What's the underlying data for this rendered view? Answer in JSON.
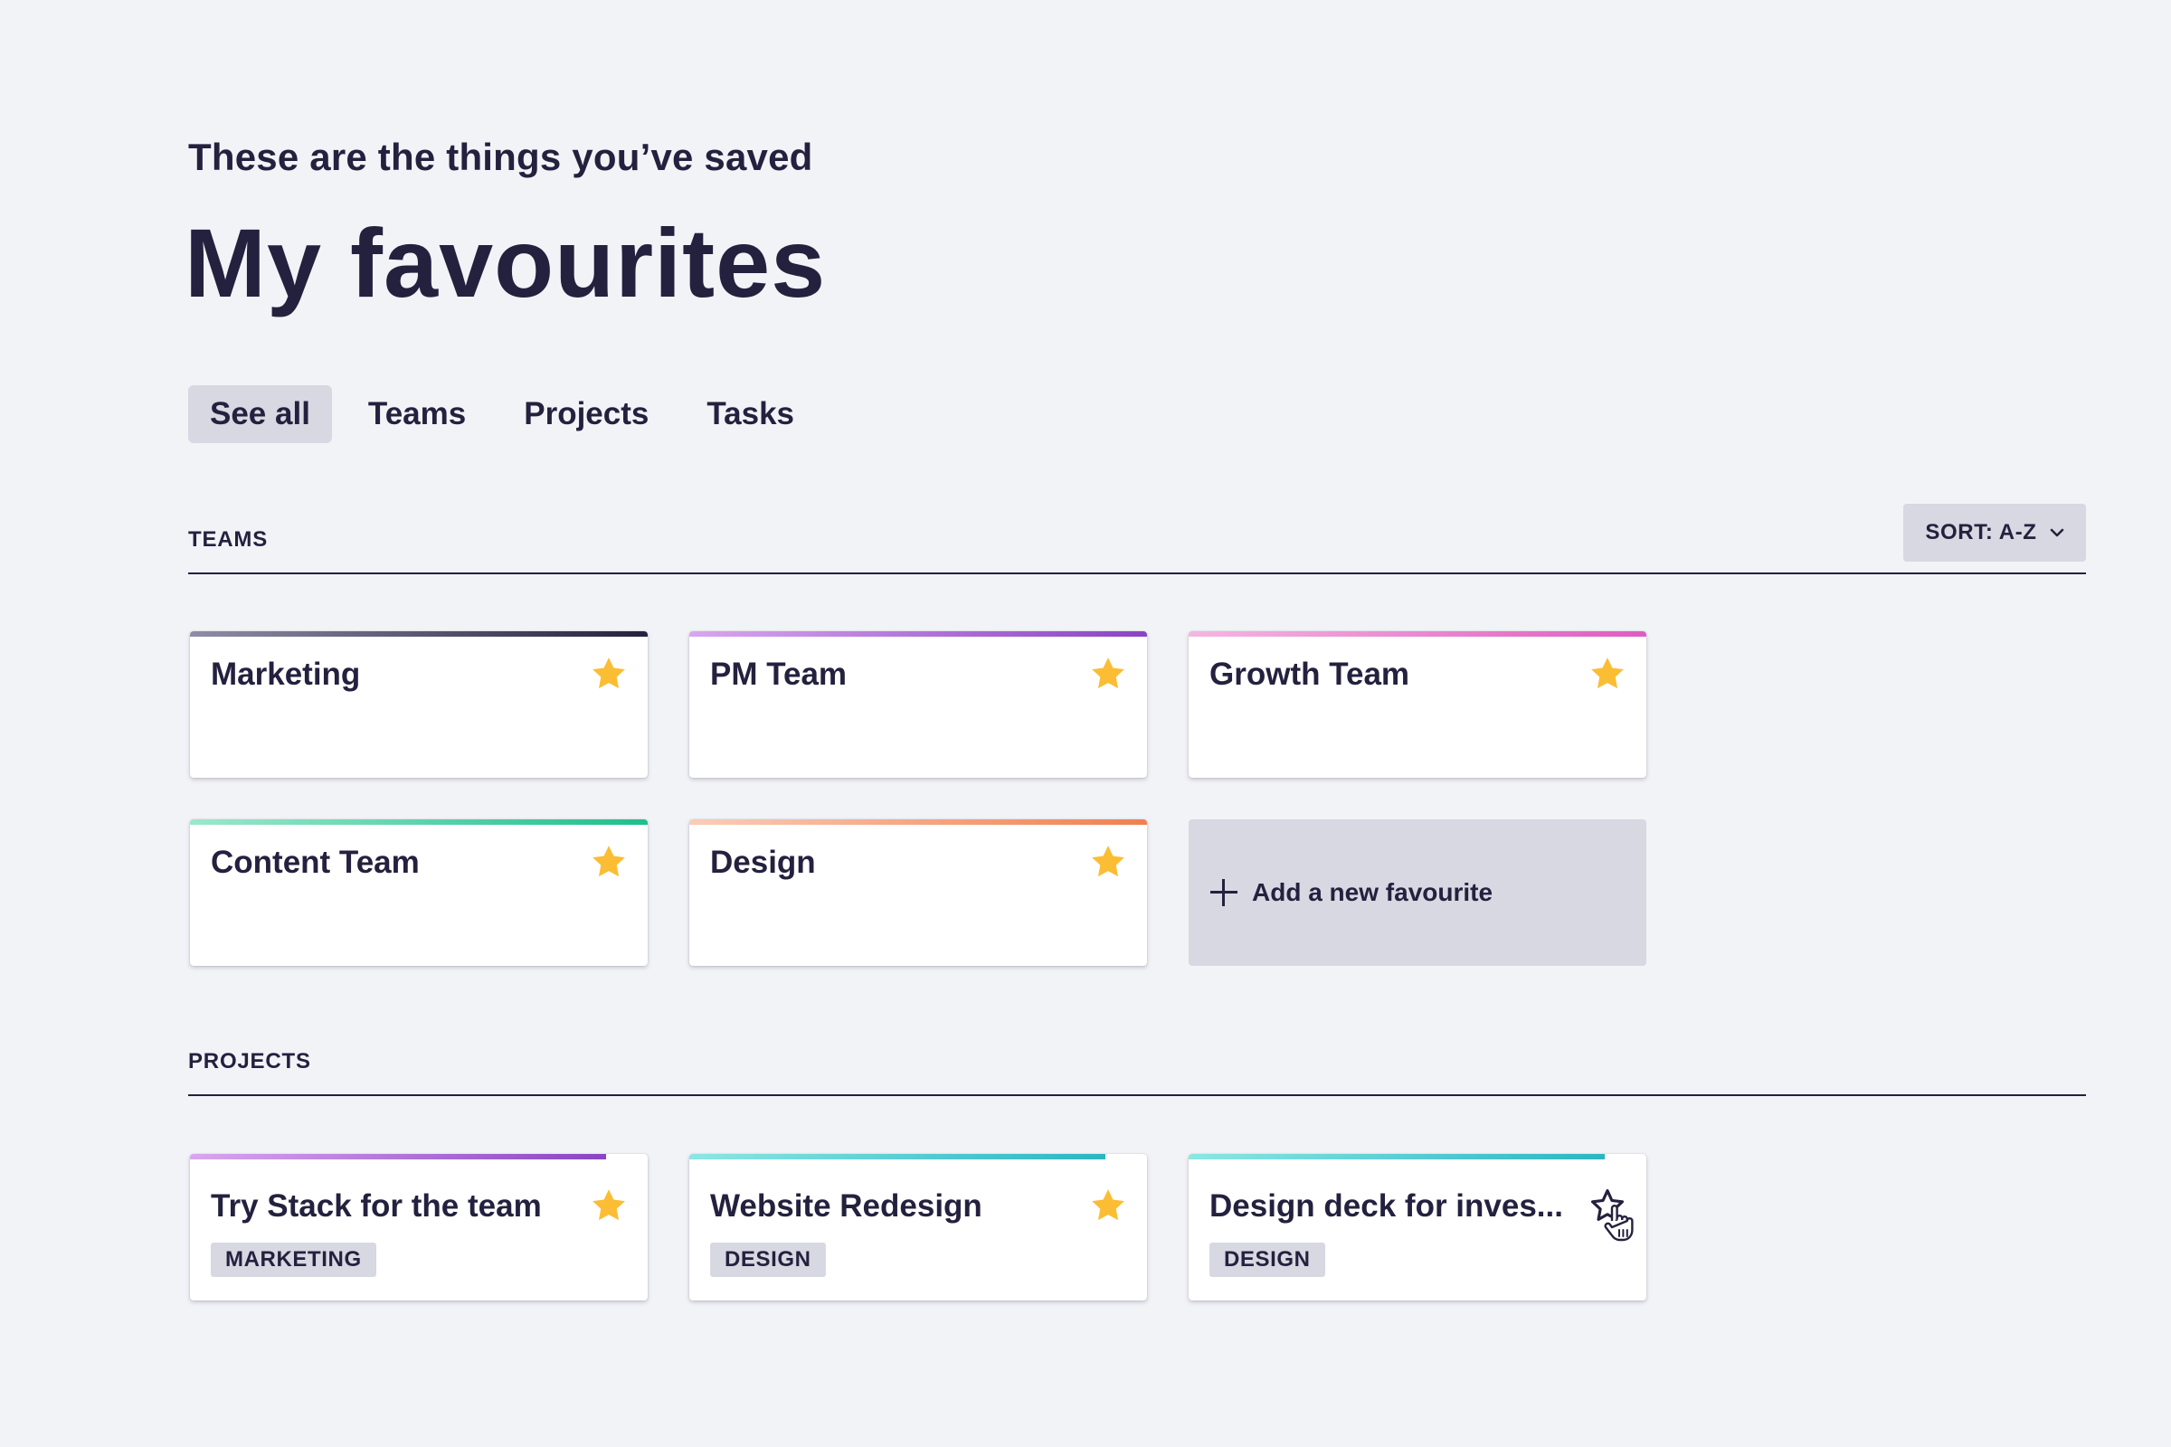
{
  "header": {
    "subtitle": "These are the things you’ve saved",
    "title": "My favourites"
  },
  "tabs": [
    {
      "label": "See all",
      "active": true
    },
    {
      "label": "Teams",
      "active": false
    },
    {
      "label": "Projects",
      "active": false
    },
    {
      "label": "Tasks",
      "active": false
    }
  ],
  "teams_section": {
    "label": "TEAMS",
    "sort_label": "SORT: A-Z",
    "cards": [
      {
        "title": "Marketing",
        "starred": true
      },
      {
        "title": "PM Team",
        "starred": true
      },
      {
        "title": "Growth Team",
        "starred": true
      },
      {
        "title": "Content Team",
        "starred": true
      },
      {
        "title": "Design",
        "starred": true
      }
    ],
    "add_label": "Add a new favourite"
  },
  "projects_section": {
    "label": "PROJECTS",
    "cards": [
      {
        "title": "Try Stack for the team",
        "tag": "MARKETING",
        "starred": true
      },
      {
        "title": "Website Redesign",
        "tag": "DESIGN",
        "starred": true
      },
      {
        "title": "Design deck for inves...",
        "tag": "DESIGN",
        "starred": false
      }
    ]
  },
  "colors": {
    "star": "#fbbd33",
    "text": "#24213f",
    "tag_bg": "#d7d8e1",
    "background": "#f2f3f7",
    "accent_marketing": "#24213f",
    "accent_pm": "#8a44c4",
    "accent_growth": "#e05cc0",
    "accent_content": "#1fbf8a",
    "accent_design": "#f0804f",
    "accent_project_purple": "#8a44c4",
    "accent_project_teal": "#2bb6c2"
  },
  "icons": {
    "star": "star-icon",
    "star_outline": "star-outline-icon",
    "chevron": "chevron-down-icon",
    "plus": "plus-icon",
    "cursor": "hand-cursor-icon"
  }
}
